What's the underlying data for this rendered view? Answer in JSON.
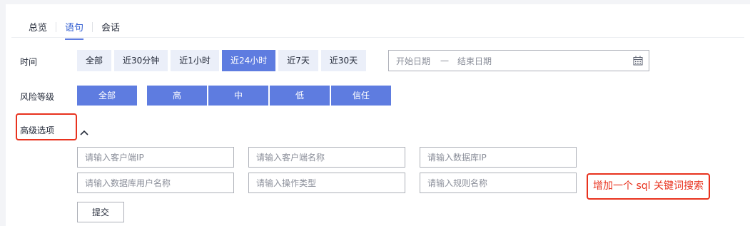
{
  "tabs": [
    {
      "label": "总览",
      "active": false
    },
    {
      "label": "语句",
      "active": true
    },
    {
      "label": "会话",
      "active": false
    }
  ],
  "time": {
    "label": "时间",
    "options": [
      "全部",
      "近30分钟",
      "近1小时",
      "近24小时",
      "近7天",
      "近30天"
    ],
    "selected": "近24小时",
    "date_range": {
      "start_placeholder": "开始日期",
      "separator": "一",
      "end_placeholder": "结束日期",
      "icon": "calendar-icon"
    }
  },
  "risk": {
    "label": "风险等级",
    "options": [
      "全部",
      "高",
      "中",
      "低",
      "信任"
    ]
  },
  "advanced": {
    "label": "高级选项",
    "toggle_icon": "chevron-up-icon",
    "fields": {
      "client_ip": "请输入客户端IP",
      "client_name": "请输入客户端名称",
      "db_ip": "请输入数据库IP",
      "db_user": "请输入数据库用户名称",
      "op_type": "请输入操作类型",
      "rule_name": "请输入规则名称"
    },
    "submit_label": "提交"
  },
  "annotation": "增加一个 sql 关键词搜索",
  "colors": {
    "accent": "#5e7ce0",
    "annotation": "#e8321e"
  }
}
